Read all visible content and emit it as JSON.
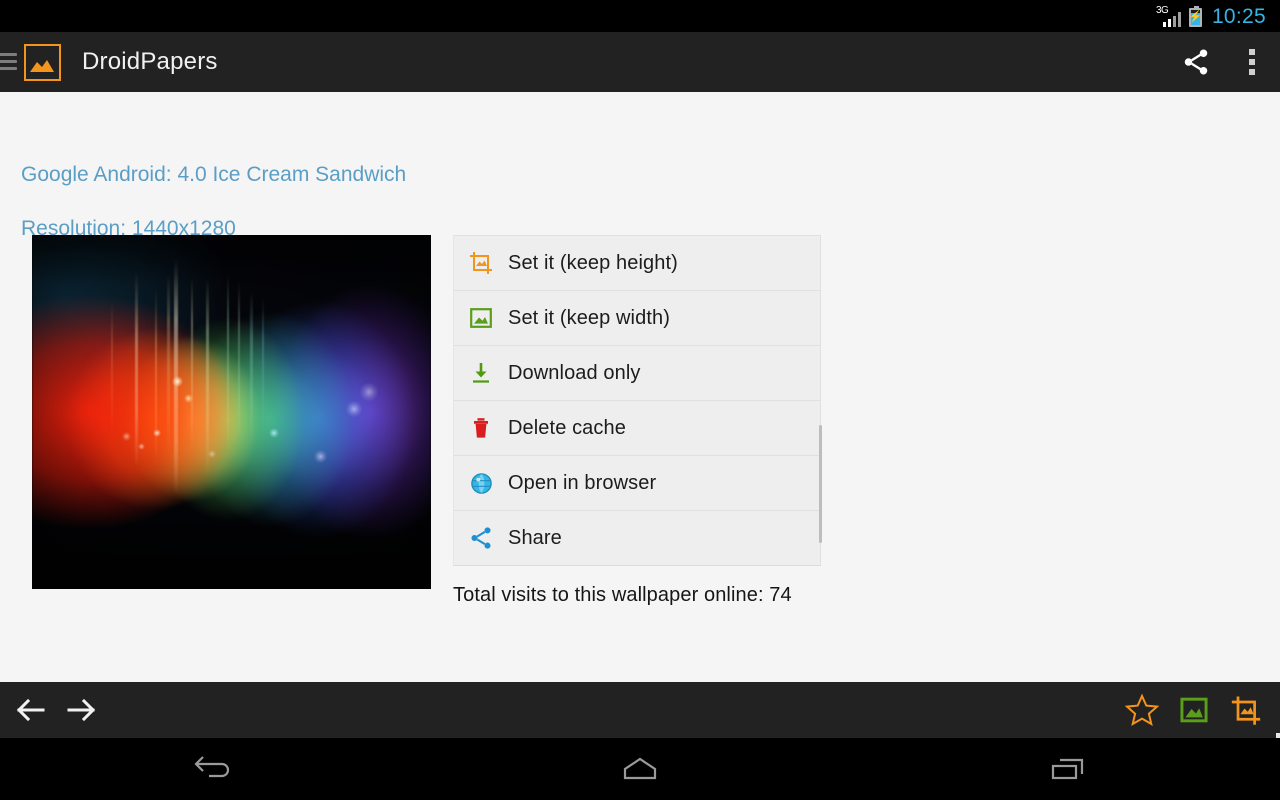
{
  "status_bar": {
    "network_label": "3G",
    "battery_icon": "battery-charging-icon",
    "signal_icon": "signal-bars-icon",
    "clock": "10:25",
    "clock_color": "#33b5e5"
  },
  "action_bar": {
    "drawer_icon": "hamburger-drawer-icon",
    "app_icon": "app-logo-image-icon",
    "title": "DroidPapers",
    "share_icon": "share-icon",
    "overflow_icon": "overflow-menu-icon",
    "background_color": "#222222",
    "accent_color": "#f3941d"
  },
  "content": {
    "meta_line_1": "Google Android: 4.0 Ice Cream Sandwich",
    "meta_line_2": "Resolution: 1440x1280",
    "meta_color": "#5b9ec5",
    "wallpaper_preview": {
      "name": "ics-nebula-spectrum-wallpaper",
      "alt": "Android Ice Cream Sandwich nebula spectrum wallpaper"
    },
    "options": [
      {
        "label": "Set it (keep height)",
        "icon": "crop-icon",
        "icon_color": "#f3941d",
        "name": "option-set-keep-height"
      },
      {
        "label": "Set it (keep width)",
        "icon": "image-icon",
        "icon_color": "#5a9e1b",
        "name": "option-set-keep-width"
      },
      {
        "label": "Download only",
        "icon": "download-icon",
        "icon_color": "#4f9a10",
        "name": "option-download-only"
      },
      {
        "label": "Delete cache",
        "icon": "trash-icon",
        "icon_color": "#d81e1e",
        "name": "option-delete-cache"
      },
      {
        "label": "Open in browser",
        "icon": "globe-icon",
        "icon_color": "#33b5e5",
        "name": "option-open-in-browser"
      },
      {
        "label": "Share",
        "icon": "share-icon",
        "icon_color": "#1e90d2",
        "name": "option-share"
      }
    ],
    "visits_text": "Total visits to this wallpaper online: 74",
    "visits_count": "74",
    "scrollbar_visible": true
  },
  "bottom_bar": {
    "prev_icon": "arrow-left-icon",
    "next_icon": "arrow-right-icon",
    "favorite_icon": "star-outline-icon",
    "set_width_icon": "image-icon",
    "set_height_icon": "crop-icon",
    "star_color": "#f3941d",
    "image_color": "#5a9e1b",
    "crop_color": "#f3941d"
  },
  "nav_bar": {
    "back_icon": "back-arrow-icon",
    "home_icon": "home-icon",
    "recents_icon": "recent-apps-icon"
  }
}
